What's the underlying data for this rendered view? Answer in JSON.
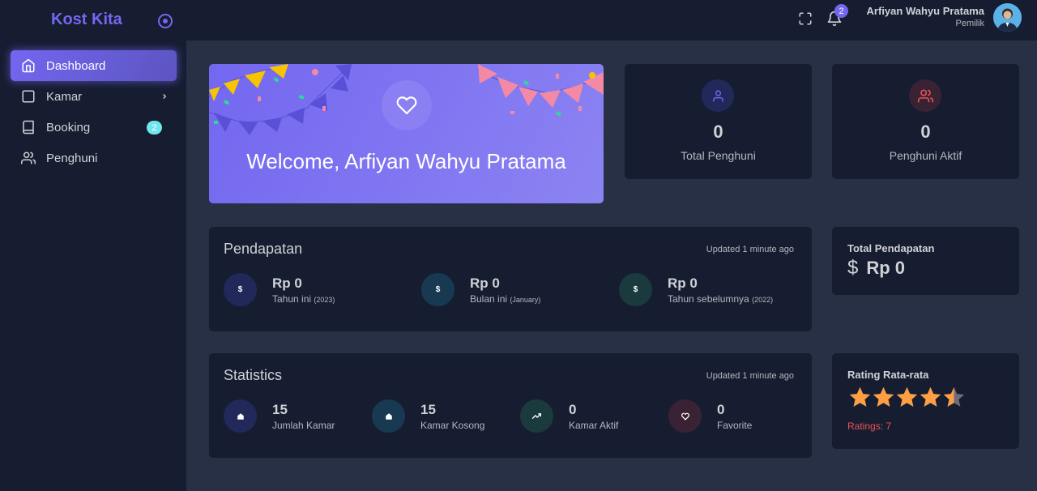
{
  "brand": {
    "name": "Kost Kita"
  },
  "sidebar": {
    "items": [
      {
        "label": "Dashboard",
        "icon": "home-icon",
        "active": true
      },
      {
        "label": "Kamar",
        "icon": "square-icon",
        "has_children": true
      },
      {
        "label": "Booking",
        "icon": "book-icon",
        "badge": "2"
      },
      {
        "label": "Penghuni",
        "icon": "users-icon"
      }
    ]
  },
  "header": {
    "notification_count": "2",
    "user_name": "Arfiyan Wahyu Pratama",
    "user_role": "Pemilik"
  },
  "welcome": {
    "text": "Welcome, Arfiyan Wahyu Pratama",
    "icon": "heart-icon"
  },
  "stats_top": [
    {
      "value": "0",
      "label": "Total Penghuni",
      "icon": "user-icon",
      "color": "#7367f0"
    },
    {
      "value": "0",
      "label": "Penghuni Aktif",
      "icon": "users-icon",
      "color": "#ea5455"
    }
  ],
  "pendapatan": {
    "title": "Pendapatan",
    "updated": "Updated 1 minute ago",
    "items": [
      {
        "value": "Rp 0",
        "label": "Tahun ini",
        "sub": "(2023)",
        "icon": "$",
        "bg": "#23285a"
      },
      {
        "value": "Rp 0",
        "label": "Bulan ini",
        "sub": "(January)",
        "icon": "$",
        "bg": "#173a52"
      },
      {
        "value": "Rp 0",
        "label": "Tahun sebelumnya",
        "sub": "(2022)",
        "icon": "$",
        "bg": "#1a3a3e"
      }
    ]
  },
  "total_pendapatan": {
    "title": "Total Pendapatan",
    "symbol": "$",
    "value": "Rp 0"
  },
  "statistics": {
    "title": "Statistics",
    "updated": "Updated 1 minute ago",
    "items": [
      {
        "value": "15",
        "label": "Jumlah Kamar",
        "icon": "home-icon",
        "bg": "#23285a"
      },
      {
        "value": "15",
        "label": "Kamar Kosong",
        "icon": "home-icon",
        "bg": "#173a52"
      },
      {
        "value": "0",
        "label": "Kamar Aktif",
        "icon": "trending-up-icon",
        "bg": "#1a3a3e"
      },
      {
        "value": "0",
        "label": "Favorite",
        "icon": "heart-icon",
        "bg": "#3a2235"
      }
    ]
  },
  "rating": {
    "title": "Rating Rata-rata",
    "stars": 4.5,
    "max": 5,
    "ratings_text": "Ratings: 7"
  }
}
